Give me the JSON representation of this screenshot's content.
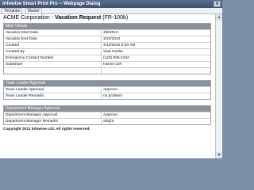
{
  "window": {
    "title": "Infowise Smart Print Pro -- Webpage Dialog",
    "close_glyph": "x"
  },
  "toolbar": {
    "template_label": "Template",
    "master_label": "Master"
  },
  "header": {
    "company": "ACME Corporation - ",
    "form_title": "Vacation Request",
    "form_code": " (FR-100b)"
  },
  "main_details": {
    "title": "Main Details",
    "rows": [
      {
        "label": "Vacation Start Date",
        "value": "3/6/2010"
      },
      {
        "label": "Vacation End Date",
        "value": "3/23/2010"
      },
      {
        "label": "Created",
        "value": "4/13/2010 8:30 AM"
      },
      {
        "label": "Created By",
        "value": "Vlad Gutlier"
      },
      {
        "label": "Emergency Contact Number",
        "value": "(123) 555-1234"
      },
      {
        "label": "Substitute",
        "value": "Hanne Lief"
      },
      {
        "label": "",
        "value": ""
      }
    ]
  },
  "team_leader": {
    "title": "Team Leader Approval",
    "rows": [
      {
        "label": "Team Leader Approval",
        "value": "Approve"
      },
      {
        "label": "Team Leader Remarks",
        "value": "no problem"
      }
    ]
  },
  "dept_manager": {
    "title": "Department Manager Approval",
    "rows": [
      {
        "label": "Department Manager Approval",
        "value": "Approve"
      },
      {
        "label": "Department Manager Remarks",
        "value": "alright"
      }
    ]
  },
  "footer": {
    "copyright": "Copyright 2011 Infowise Ltd. All rights reserved."
  },
  "scrollbar": {
    "up_glyph": "▲",
    "down_glyph": "▼"
  }
}
